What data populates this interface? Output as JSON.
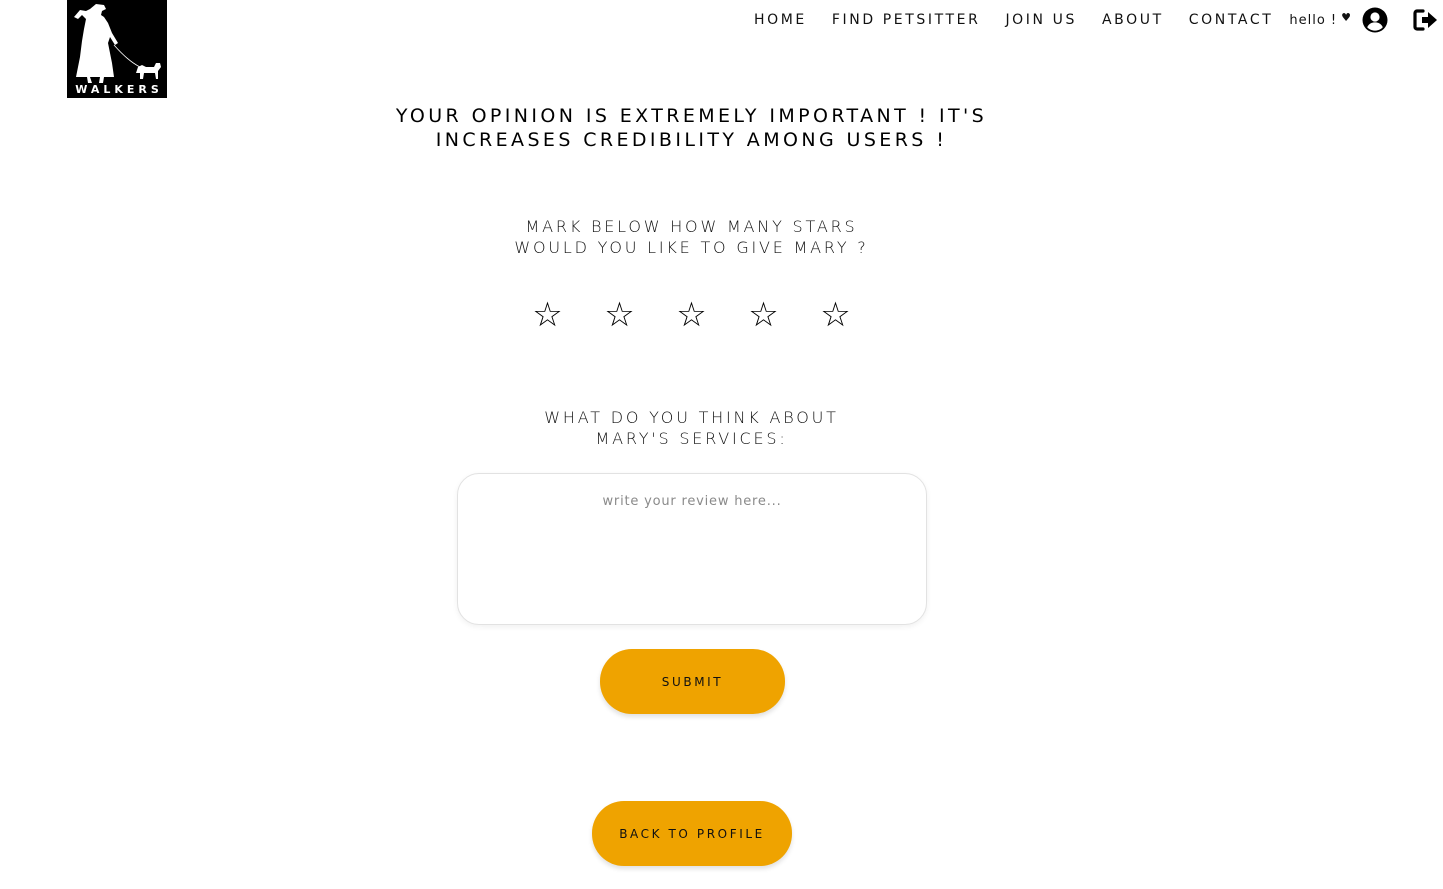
{
  "brand": {
    "logo_text": "WALKERS"
  },
  "nav": {
    "items": [
      {
        "label": "HOME"
      },
      {
        "label": "FIND PETSITTER"
      },
      {
        "label": "JOIN US"
      },
      {
        "label": "ABOUT"
      },
      {
        "label": "CONTACT"
      }
    ],
    "greeting": "hello !",
    "greeting_heart": "♥",
    "user_icon": "user-circle-icon",
    "logout_icon": "sign-out-icon"
  },
  "main": {
    "headline_line1": "YOUR OPINION IS EXTREMELY IMPORTANT ! IT'S",
    "headline_line2": "INCREASES CREDIBILITY AMONG USERS !",
    "stars_prompt_line1": "MARK BELOW HOW MANY STARS",
    "stars_prompt_line2": "WOULD YOU LIKE TO GIVE MARY ?",
    "rating": {
      "max": 5,
      "selected": 0,
      "star_glyph": "☆"
    },
    "review_prompt_line1": "WHAT DO YOU THINK ABOUT",
    "review_prompt_line2": "MARY'S SERVICES:",
    "review_placeholder": "write your review here...",
    "review_value": "",
    "submit_label": "SUBMIT",
    "back_label": "BACK TO PROFILE"
  },
  "colors": {
    "accent": "#efa300",
    "text": "#000000",
    "background": "#ffffff"
  }
}
